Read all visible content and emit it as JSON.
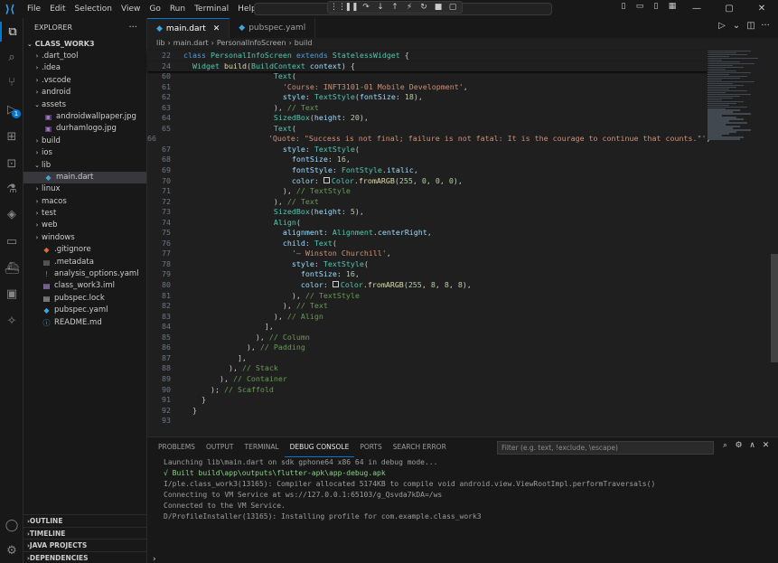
{
  "titlebar": {
    "menu": [
      "File",
      "Edit",
      "Selection",
      "View",
      "Go",
      "Run",
      "Terminal",
      "Help"
    ],
    "debug_icons": [
      "⋮⋮",
      "❚❚",
      "↷",
      "↓",
      "↑",
      "⚡",
      "↻",
      "■",
      "▢"
    ],
    "layout_icons": [
      "▯",
      "▭",
      "▯",
      "▦"
    ],
    "window_icons": [
      "—",
      "▢",
      "✕"
    ]
  },
  "activity": {
    "items": [
      "explorer",
      "search",
      "source-control",
      "run-debug",
      "extensions",
      "remote",
      "testing",
      "flutter",
      "chat",
      "docker",
      "containers",
      "kubernetes"
    ],
    "badge": "1"
  },
  "sidebar": {
    "title": "EXPLORER",
    "dots": "···",
    "root": "CLASS_WORK3",
    "items": [
      {
        "label": ".dart_tool",
        "type": "folder",
        "depth": 1
      },
      {
        "label": ".idea",
        "type": "folder",
        "depth": 1
      },
      {
        "label": ".vscode",
        "type": "folder",
        "depth": 1
      },
      {
        "label": "android",
        "type": "folder",
        "depth": 1
      },
      {
        "label": "assets",
        "type": "folder-open",
        "depth": 1
      },
      {
        "label": "androidwallpaper.jpg",
        "type": "image",
        "depth": 2
      },
      {
        "label": "durhamlogo.jpg",
        "type": "image",
        "depth": 2
      },
      {
        "label": "build",
        "type": "folder",
        "depth": 1
      },
      {
        "label": "ios",
        "type": "folder",
        "depth": 1
      },
      {
        "label": "lib",
        "type": "folder-open",
        "depth": 1
      },
      {
        "label": "main.dart",
        "type": "dart",
        "depth": 2,
        "selected": true
      },
      {
        "label": "linux",
        "type": "folder",
        "depth": 1
      },
      {
        "label": "macos",
        "type": "folder",
        "depth": 1
      },
      {
        "label": "test",
        "type": "folder",
        "depth": 1
      },
      {
        "label": "web",
        "type": "folder",
        "depth": 1
      },
      {
        "label": "windows",
        "type": "folder",
        "depth": 1
      },
      {
        "label": ".gitignore",
        "type": "git",
        "depth": 1
      },
      {
        "label": ".metadata",
        "type": "meta",
        "depth": 1
      },
      {
        "label": "analysis_options.yaml",
        "type": "yaml-red",
        "depth": 1
      },
      {
        "label": "class_work3.iml",
        "type": "iml",
        "depth": 1
      },
      {
        "label": "pubspec.lock",
        "type": "lock",
        "depth": 1
      },
      {
        "label": "pubspec.yaml",
        "type": "dart",
        "depth": 1
      },
      {
        "label": "README.md",
        "type": "info",
        "depth": 1
      }
    ],
    "bottom_sections": [
      "OUTLINE",
      "TIMELINE",
      "JAVA PROJECTS",
      "DEPENDENCIES"
    ]
  },
  "editor": {
    "tabs": [
      {
        "label": "main.dart",
        "active": true,
        "close": "✕"
      },
      {
        "label": "pubspec.yaml",
        "active": false,
        "close": ""
      }
    ],
    "actions": [
      "▷",
      "⌄",
      "◫",
      "···"
    ],
    "breadcrumb": [
      "lib",
      "main.dart",
      "PersonalInfoScreen",
      "build"
    ],
    "breadcrumb_sep": "›"
  },
  "code": {
    "sticky": [
      {
        "n": "22",
        "html": "<span class='kw'>class</span> <span class='cls'>PersonalInfoScreen</span> <span class='kw'>extends</span> <span class='cls'>StatelessWidget</span> {"
      },
      {
        "n": "24",
        "html": "  <span class='cls'>Widget</span> <span class='fn'>build</span>(<span class='cls'>BuildContext</span> <span class='prop'>context</span>) {"
      }
    ],
    "lines": [
      {
        "n": "60",
        "html": "                    <span class='cls'>Text</span>("
      },
      {
        "n": "61",
        "html": "                      <span class='str'>'Course: INFT3101-01 Mobile Development'</span>,"
      },
      {
        "n": "62",
        "html": "                      <span class='prop'>style</span>: <span class='cls'>TextStyle</span>(<span class='prop'>fontSize</span>: <span class='num'>18</span>),"
      },
      {
        "n": "63",
        "html": "                    ), <span class='cmt'>// Text</span>"
      },
      {
        "n": "64",
        "html": "                    <span class='cls'>SizedBox</span>(<span class='prop'>height</span>: <span class='num'>20</span>),"
      },
      {
        "n": "65",
        "html": "                    <span class='cls'>Text</span>("
      },
      {
        "n": "66",
        "html": "                      <span class='str'>'Quote: \"Success is not final; failure is not fatal: It is the courage to continue that counts.\"'</span>,"
      },
      {
        "n": "67",
        "html": "                      <span class='prop'>style</span>: <span class='cls'>TextStyle</span>("
      },
      {
        "n": "68",
        "html": "                        <span class='prop'>fontSize</span>: <span class='num'>16</span>,"
      },
      {
        "n": "69",
        "html": "                        <span class='prop'>fontStyle</span>: <span class='cls'>FontStyle</span>.<span class='prop'>italic</span>,"
      },
      {
        "n": "70",
        "html": "                        <span class='prop'>color</span>: <span class='sw'></span><span class='cls'>Color</span>.<span class='fn'>fromARGB</span>(<span class='num'>255</span>, <span class='num'>0</span>, <span class='num'>0</span>, <span class='num'>0</span>),"
      },
      {
        "n": "71",
        "html": "                      ), <span class='cmt'>// TextStyle</span>"
      },
      {
        "n": "72",
        "html": "                    ), <span class='cmt'>// Text</span>"
      },
      {
        "n": "73",
        "html": "                    <span class='cls'>SizedBox</span>(<span class='prop'>height</span>: <span class='num'>5</span>),"
      },
      {
        "n": "74",
        "html": "                    <span class='cls'>Align</span>("
      },
      {
        "n": "75",
        "html": "                      <span class='prop'>alignment</span>: <span class='cls'>Alignment</span>.<span class='prop'>centerRight</span>,"
      },
      {
        "n": "76",
        "html": "                      <span class='prop'>child</span>: <span class='cls'>Text</span>("
      },
      {
        "n": "77",
        "html": "                        <span class='str'>'— Winston Churchill'</span>,"
      },
      {
        "n": "78",
        "html": "                        <span class='prop'>style</span>: <span class='cls'>TextStyle</span>("
      },
      {
        "n": "79",
        "html": "                          <span class='prop'>fontSize</span>: <span class='num'>16</span>,"
      },
      {
        "n": "80",
        "html": "                          <span class='prop'>color</span>: <span class='sw'></span><span class='cls'>Color</span>.<span class='fn'>fromARGB</span>(<span class='num'>255</span>, <span class='num'>8</span>, <span class='num'>8</span>, <span class='num'>8</span>),"
      },
      {
        "n": "81",
        "html": "                        ), <span class='cmt'>// TextStyle</span>"
      },
      {
        "n": "82",
        "html": "                      ), <span class='cmt'>// Text</span>"
      },
      {
        "n": "83",
        "html": "                    ), <span class='cmt'>// Align</span>"
      },
      {
        "n": "84",
        "html": "                  ],"
      },
      {
        "n": "85",
        "html": "                ), <span class='cmt'>// Column</span>"
      },
      {
        "n": "86",
        "html": "              ), <span class='cmt'>// Padding</span>"
      },
      {
        "n": "87",
        "html": "            ],"
      },
      {
        "n": "88",
        "html": "          ), <span class='cmt'>// Stack</span>"
      },
      {
        "n": "89",
        "html": "        ), <span class='cmt'>// Container</span>"
      },
      {
        "n": "90",
        "html": "      ); <span class='cmt'>// Scaffold</span>"
      },
      {
        "n": "91",
        "html": "    }"
      },
      {
        "n": "92",
        "html": "  }"
      },
      {
        "n": "93",
        "html": ""
      }
    ]
  },
  "panel": {
    "tabs": [
      "PROBLEMS",
      "OUTPUT",
      "TERMINAL",
      "DEBUG CONSOLE",
      "PORTS",
      "SEARCH ERROR"
    ],
    "active_tab": "DEBUG CONSOLE",
    "filter_placeholder": "Filter (e.g. text, !exclude, \\escape)",
    "icons": [
      "⌕",
      "⚙",
      "∧",
      "✕"
    ],
    "console": [
      {
        "text": "Launching lib\\main.dart on sdk gphone64 x86 64 in debug mode...",
        "ok": false
      },
      {
        "text": "√ Built build\\app\\outputs\\flutter-apk\\app-debug.apk",
        "ok": true
      },
      {
        "text": "I/ple.class_work3(13165): Compiler allocated 5174KB to compile void android.view.ViewRootImpl.performTraversals()",
        "ok": false
      },
      {
        "text": "Connecting to VM Service at ws://127.0.0.1:65103/g_Qsvda7kDA=/ws",
        "ok": false
      },
      {
        "text": "Connected to the VM Service.",
        "ok": false
      },
      {
        "text": "D/ProfileInstaller(13165): Installing profile for com.example.class_work3",
        "ok": false
      }
    ],
    "prompt": "›"
  }
}
